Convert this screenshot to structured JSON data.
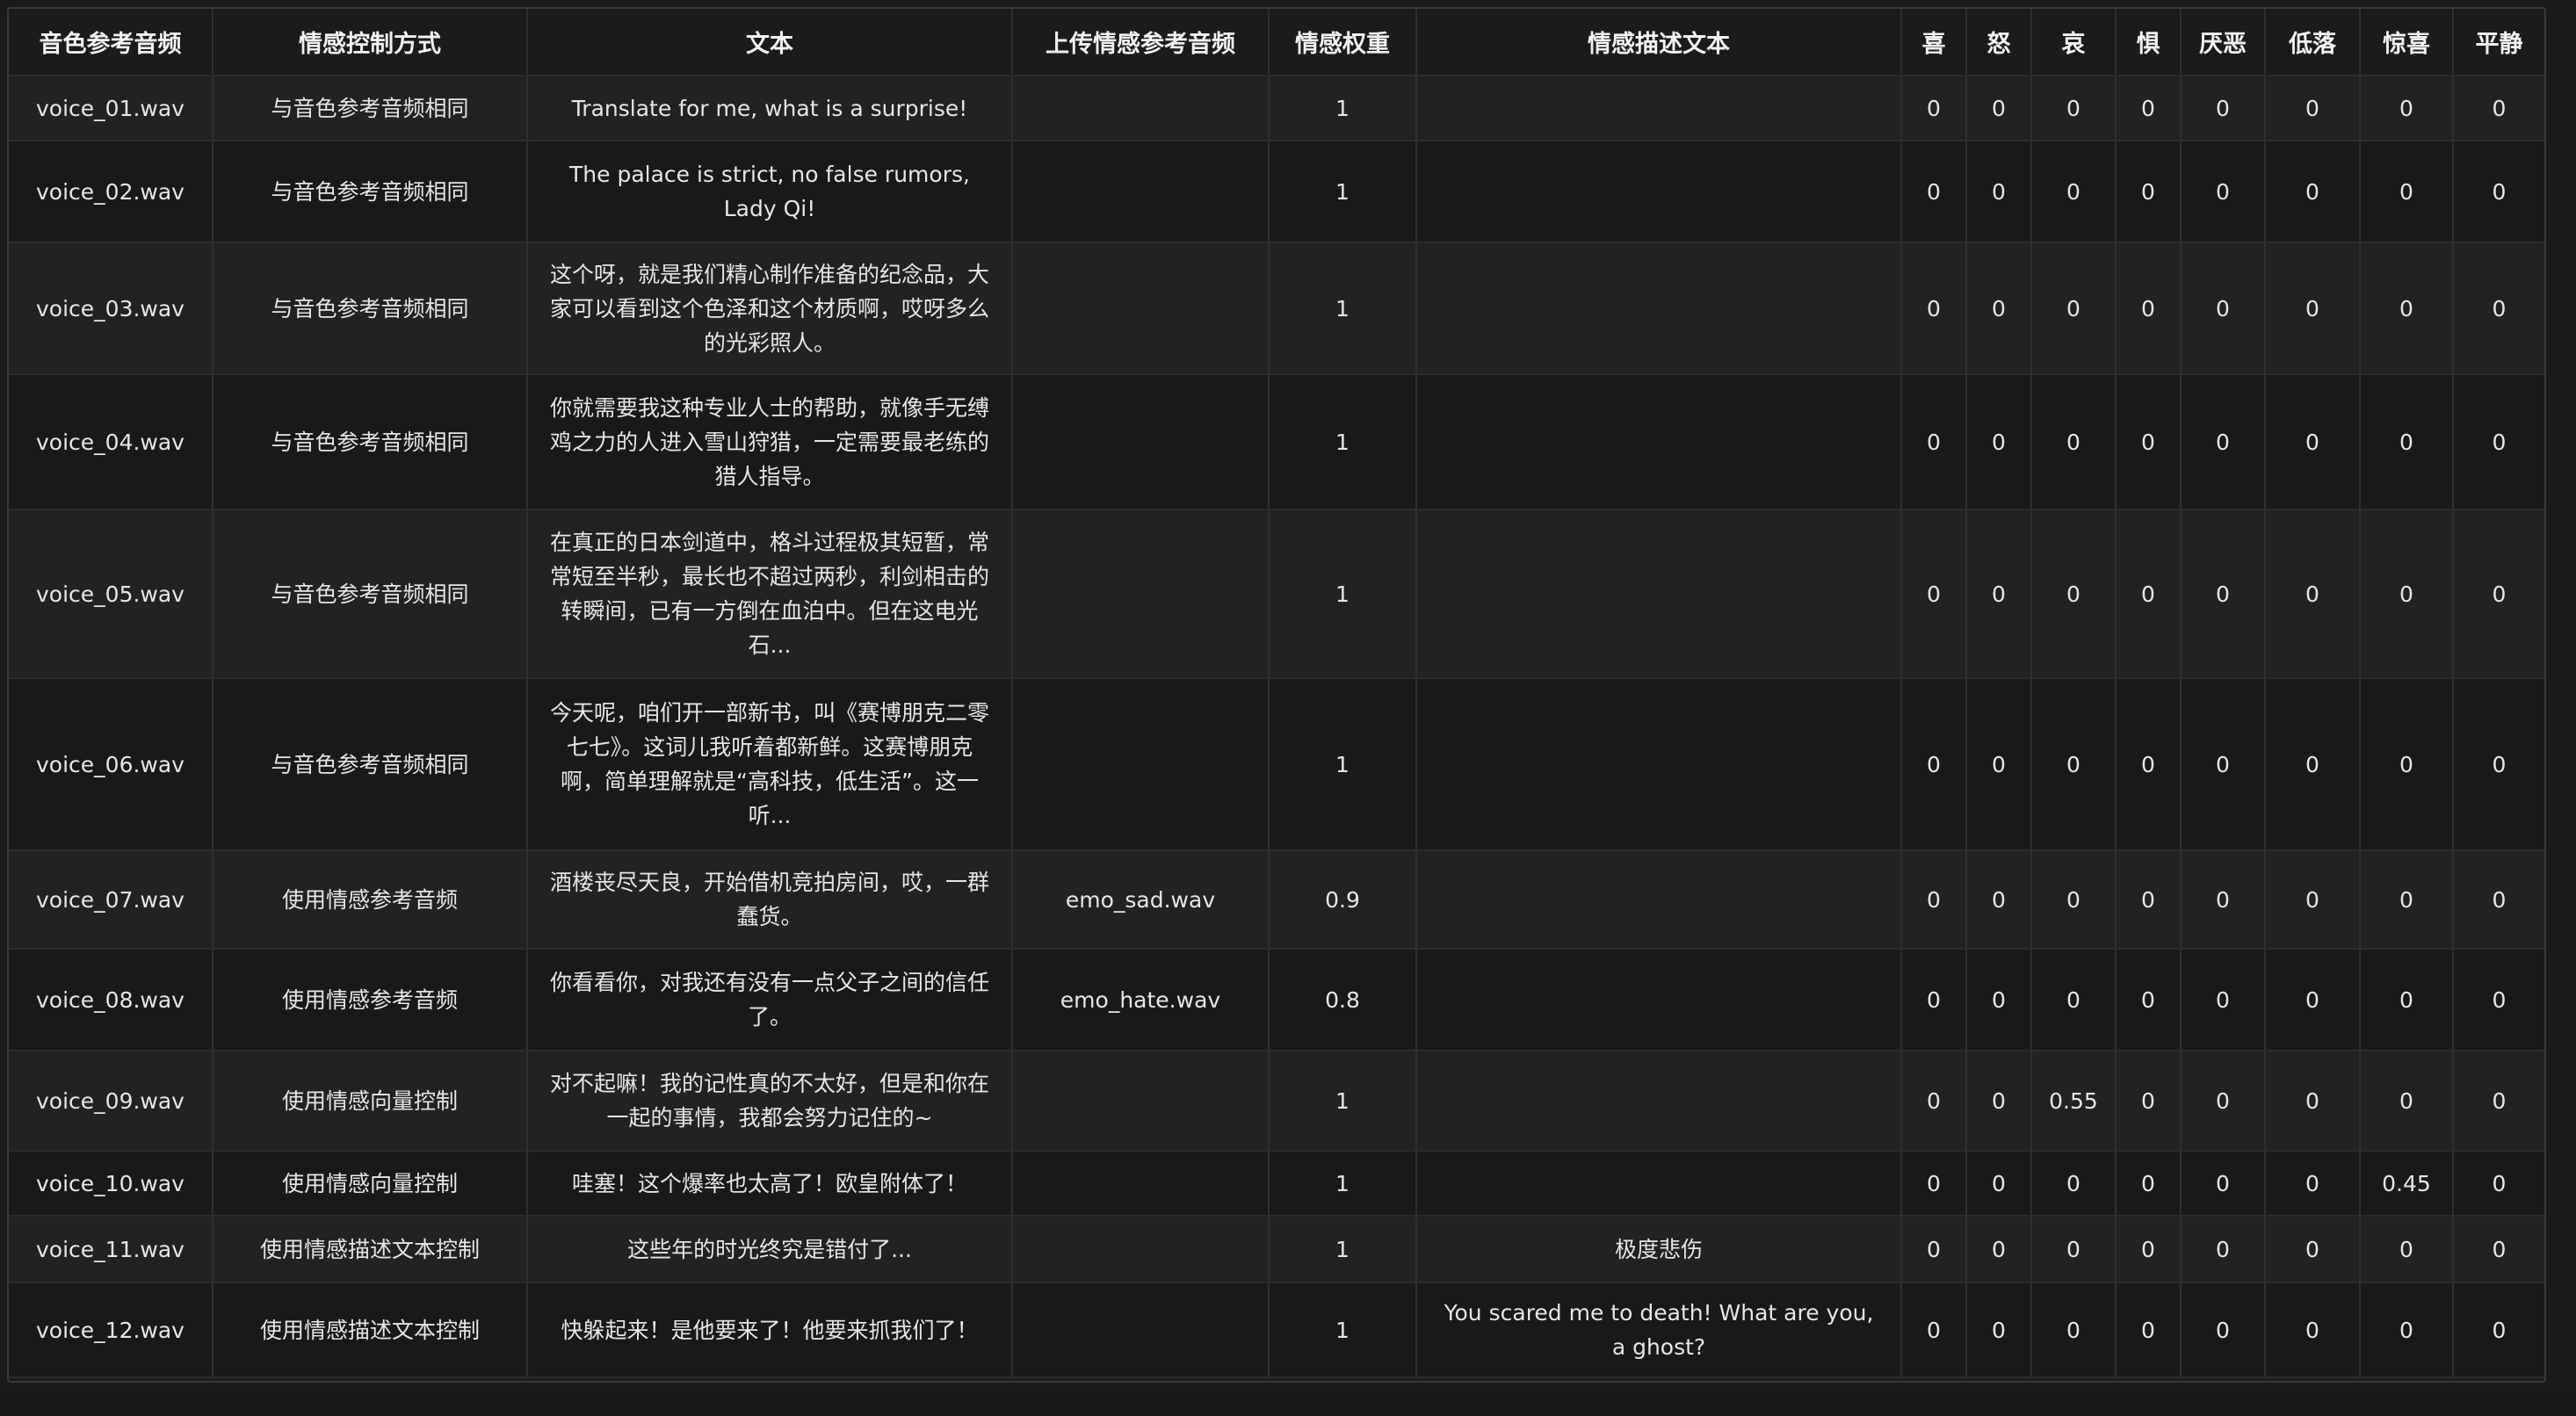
{
  "table": {
    "headers": [
      "音色参考音频",
      "情感控制方式",
      "文本",
      "上传情感参考音频",
      "情感权重",
      "情感描述文本",
      "喜",
      "怒",
      "哀",
      "惧",
      "厌恶",
      "低落",
      "惊喜",
      "平静"
    ],
    "rows": [
      [
        "voice_01.wav",
        "与音色参考音频相同",
        "Translate for me, what is a surprise!",
        "",
        "1",
        "",
        "0",
        "0",
        "0",
        "0",
        "0",
        "0",
        "0",
        "0"
      ],
      [
        "voice_02.wav",
        "与音色参考音频相同",
        "The palace is strict, no false rumors, Lady Qi!",
        "",
        "1",
        "",
        "0",
        "0",
        "0",
        "0",
        "0",
        "0",
        "0",
        "0"
      ],
      [
        "voice_03.wav",
        "与音色参考音频相同",
        "这个呀，就是我们精心制作准备的纪念品，大家可以看到这个色泽和这个材质啊，哎呀多么的光彩照人。",
        "",
        "1",
        "",
        "0",
        "0",
        "0",
        "0",
        "0",
        "0",
        "0",
        "0"
      ],
      [
        "voice_04.wav",
        "与音色参考音频相同",
        "你就需要我这种专业人士的帮助，就像手无缚鸡之力的人进入雪山狩猎，一定需要最老练的猎人指导。",
        "",
        "1",
        "",
        "0",
        "0",
        "0",
        "0",
        "0",
        "0",
        "0",
        "0"
      ],
      [
        "voice_05.wav",
        "与音色参考音频相同",
        "在真正的日本剑道中，格斗过程极其短暂，常常短至半秒，最长也不超过两秒，利剑相击的转瞬间，已有一方倒在血泊中。但在这电光石...",
        "",
        "1",
        "",
        "0",
        "0",
        "0",
        "0",
        "0",
        "0",
        "0",
        "0"
      ],
      [
        "voice_06.wav",
        "与音色参考音频相同",
        "今天呢，咱们开一部新书，叫《赛博朋克二零七七》。这词儿我听着都新鲜。这赛博朋克啊，简单理解就是“高科技，低生活”。这一听...",
        "",
        "1",
        "",
        "0",
        "0",
        "0",
        "0",
        "0",
        "0",
        "0",
        "0"
      ],
      [
        "voice_07.wav",
        "使用情感参考音频",
        "酒楼丧尽天良，开始借机竞拍房间，哎，一群蠢货。",
        "emo_sad.wav",
        "0.9",
        "",
        "0",
        "0",
        "0",
        "0",
        "0",
        "0",
        "0",
        "0"
      ],
      [
        "voice_08.wav",
        "使用情感参考音频",
        "你看看你，对我还有没有一点父子之间的信任了。",
        "emo_hate.wav",
        "0.8",
        "",
        "0",
        "0",
        "0",
        "0",
        "0",
        "0",
        "0",
        "0"
      ],
      [
        "voice_09.wav",
        "使用情感向量控制",
        "对不起嘛！我的记性真的不太好，但是和你在一起的事情，我都会努力记住的~",
        "",
        "1",
        "",
        "0",
        "0",
        "0.55",
        "0",
        "0",
        "0",
        "0",
        "0"
      ],
      [
        "voice_10.wav",
        "使用情感向量控制",
        "哇塞！这个爆率也太高了！欧皇附体了！",
        "",
        "1",
        "",
        "0",
        "0",
        "0",
        "0",
        "0",
        "0",
        "0.45",
        "0"
      ],
      [
        "voice_11.wav",
        "使用情感描述文本控制",
        "这些年的时光终究是错付了...",
        "",
        "1",
        "极度悲伤",
        "0",
        "0",
        "0",
        "0",
        "0",
        "0",
        "0",
        "0"
      ],
      [
        "voice_12.wav",
        "使用情感描述文本控制",
        "快躲起来！是他要来了！他要来抓我们了！",
        "",
        "1",
        "You scared me to death! What are you, a ghost?",
        "0",
        "0",
        "0",
        "0",
        "0",
        "0",
        "0",
        "0"
      ]
    ]
  }
}
